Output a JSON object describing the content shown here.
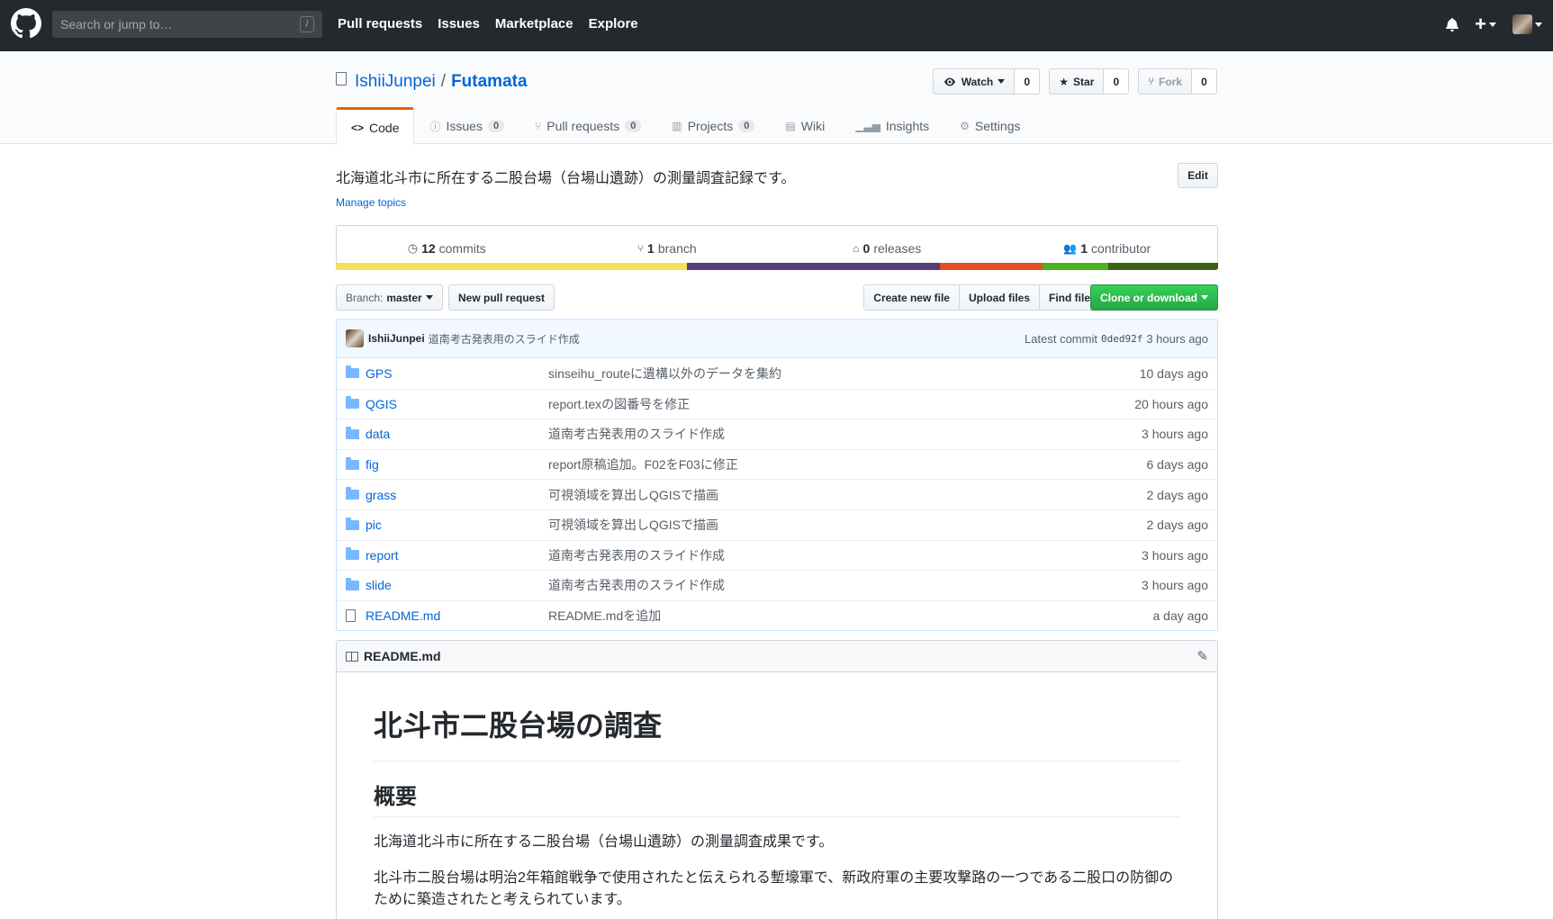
{
  "topbar": {
    "search_placeholder": "Search or jump to…",
    "search_key": "/",
    "nav": [
      "Pull requests",
      "Issues",
      "Marketplace",
      "Explore"
    ],
    "plus": "+"
  },
  "repo": {
    "owner": "IshiiJunpei",
    "separator": "/",
    "name": "Futamata",
    "watch_label": "Watch",
    "watch_count": "0",
    "star_label": "Star",
    "star_count": "0",
    "fork_label": "Fork",
    "fork_count": "0"
  },
  "tabs": [
    {
      "label": "Code",
      "icon": "code-icon"
    },
    {
      "label": "Issues",
      "count": "0",
      "icon": "issue-icon"
    },
    {
      "label": "Pull requests",
      "count": "0",
      "icon": "pull-request-icon"
    },
    {
      "label": "Projects",
      "count": "0",
      "icon": "project-icon"
    },
    {
      "label": "Wiki",
      "icon": "book-icon"
    },
    {
      "label": "Insights",
      "icon": "graph-icon"
    },
    {
      "label": "Settings",
      "icon": "gear-icon"
    }
  ],
  "description": "北海道北斗市に所在する二股台場（台場山遺跡）の測量調査記録です。",
  "edit_label": "Edit",
  "manage_topics": "Manage topics",
  "summary": {
    "commits_num": "12",
    "commits_label": "commits",
    "branch_num": "1",
    "branch_label": "branch",
    "releases_num": "0",
    "releases_label": "releases",
    "contrib_num": "1",
    "contrib_label": "contributor"
  },
  "language_colors": [
    "#f1e05a",
    "#563d7c",
    "#e34c26",
    "#4eb21c",
    "#3d6117"
  ],
  "filebar": {
    "branch_prefix": "Branch:",
    "branch_name": "master",
    "new_pr": "New pull request",
    "create_file": "Create new file",
    "upload_files": "Upload files",
    "find_file": "Find file",
    "clone": "Clone or download"
  },
  "latest_commit": {
    "author": "IshiiJunpei",
    "message": "道南考古発表用のスライド作成",
    "prefix": "Latest commit",
    "sha": "0ded92f",
    "age": "3 hours ago"
  },
  "files": [
    {
      "type": "dir",
      "name": "GPS",
      "message": "sinseihu_routeに遺構以外のデータを集約",
      "age": "10 days ago"
    },
    {
      "type": "dir",
      "name": "QGIS",
      "message": "report.texの図番号を修正",
      "age": "20 hours ago"
    },
    {
      "type": "dir",
      "name": "data",
      "message": "道南考古発表用のスライド作成",
      "age": "3 hours ago"
    },
    {
      "type": "dir",
      "name": "fig",
      "message": "report原稿追加。F02をF03に修正",
      "age": "6 days ago"
    },
    {
      "type": "dir",
      "name": "grass",
      "message": "可視領域を算出しQGISで描画",
      "age": "2 days ago"
    },
    {
      "type": "dir",
      "name": "pic",
      "message": "可視領域を算出しQGISで描画",
      "age": "2 days ago"
    },
    {
      "type": "dir",
      "name": "report",
      "message": "道南考古発表用のスライド作成",
      "age": "3 hours ago"
    },
    {
      "type": "dir",
      "name": "slide",
      "message": "道南考古発表用のスライド作成",
      "age": "3 hours ago"
    },
    {
      "type": "file",
      "name": "README.md",
      "message": "README.mdを追加",
      "age": "a day ago"
    }
  ],
  "readme": {
    "filename": "README.md",
    "h1": "北斗市二股台場の調査",
    "h2": "概要",
    "p1": "北海道北斗市に所在する二股台場（台場山遺跡）の測量調査成果です。",
    "p2": "北斗市二股台場は明治2年箱館戦争で使用されたと伝えられる塹壕軍で、新政府軍の主要攻撃路の一つである二股口の防御のために築造されたと考えられています。"
  }
}
